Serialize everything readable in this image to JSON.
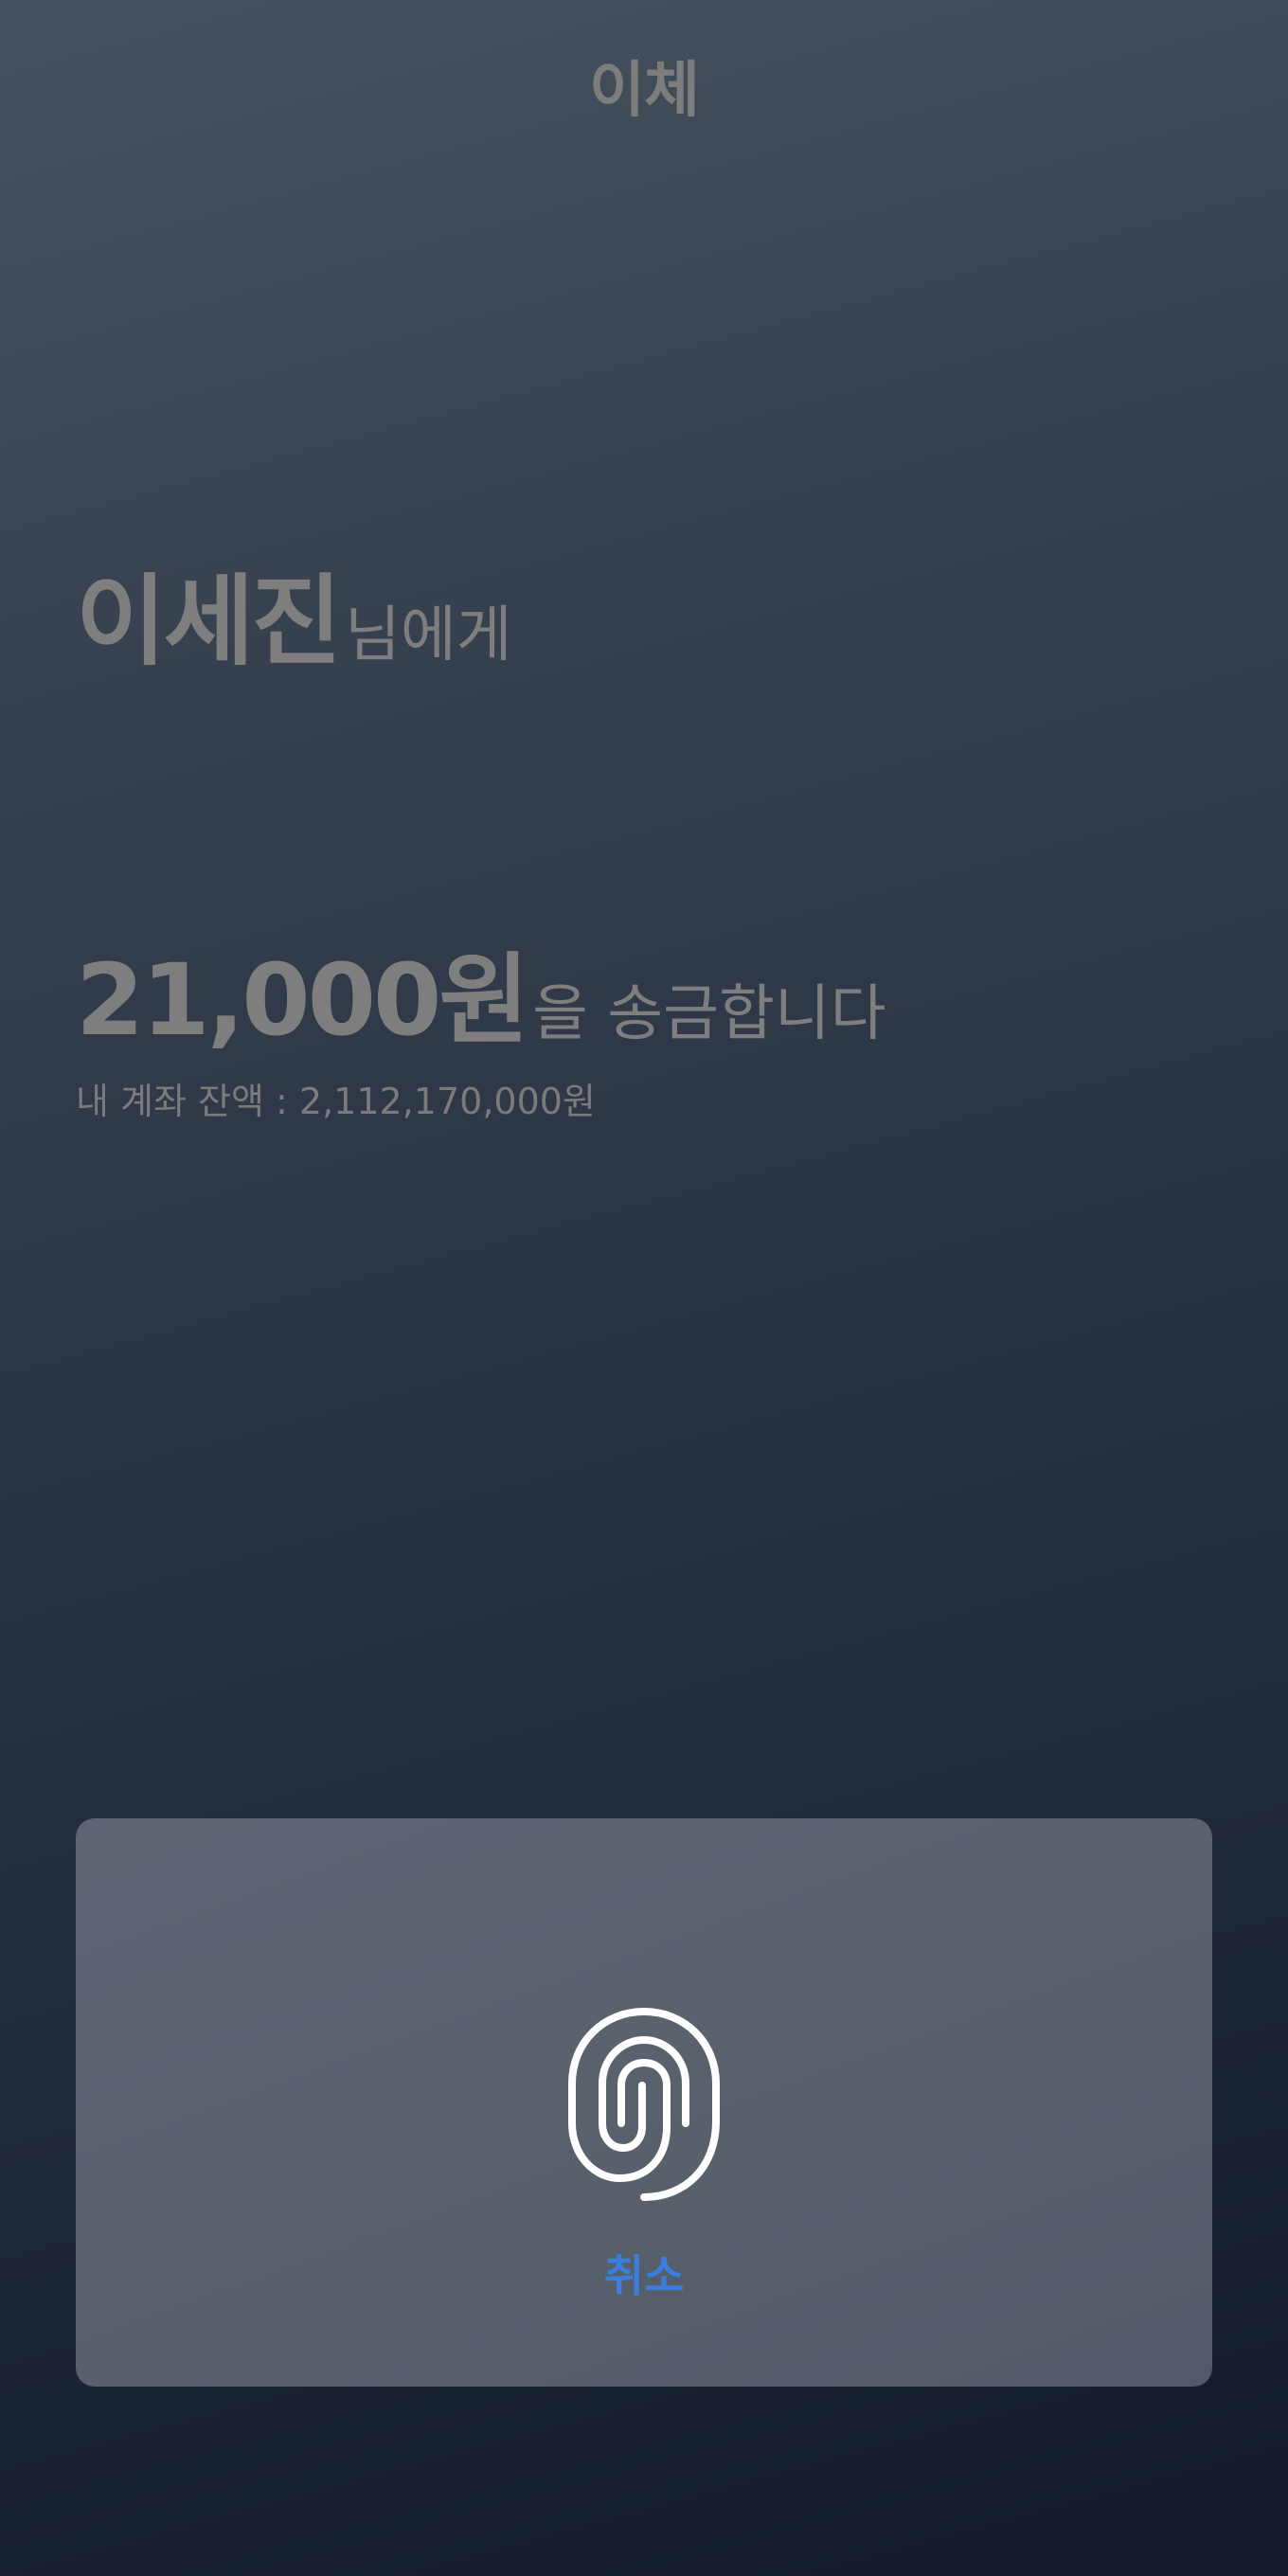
{
  "header": {
    "title": "이체"
  },
  "recipient": {
    "name": "이세진",
    "suffix": "님에게"
  },
  "transfer": {
    "amount": "21,000원",
    "suffix": "을 송금합니다",
    "balance_text": "내 계좌 잔액 : 2,112,170,000원"
  },
  "auth_panel": {
    "icon": "fingerprint-icon",
    "cancel_label": "취소"
  },
  "colors": {
    "background_top": "#47525f",
    "background_bottom": "#121a29",
    "panel": "#59616d",
    "text_muted": "#7e7e7e",
    "accent": "#3a7fdc",
    "icon": "#ffffff"
  }
}
